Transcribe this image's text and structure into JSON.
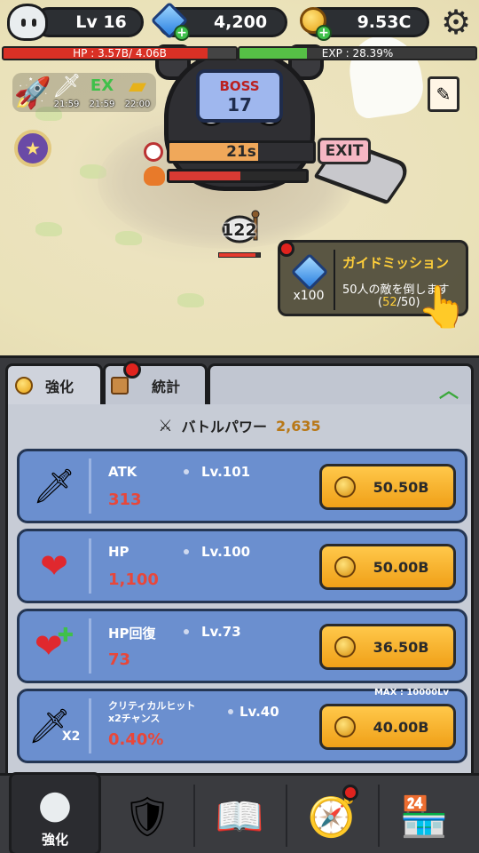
{
  "header": {
    "level": "Lv 16",
    "gems": "4,200",
    "gold": "9.53C",
    "hp_label": "HP : 3.57B/ 4.06B",
    "hp_fraction": 0.879,
    "exp_label": "EXP : 28.39%",
    "exp_fraction": 0.2839
  },
  "buffs": [
    {
      "icon": "atk-boost-icon",
      "time": "21:59"
    },
    {
      "icon": "exp-boost-icon",
      "time": "21:59"
    },
    {
      "icon": "gold-boost-icon",
      "time": "22:00"
    }
  ],
  "boss": {
    "label": "BOSS",
    "stage": "17",
    "timer": "21s",
    "timer_fraction": 0.62,
    "hp_fraction": 0.52,
    "exit_label": "EXIT"
  },
  "hero": {
    "damage": "122",
    "hp_fraction": 0.9
  },
  "guide": {
    "reward_count": "x100",
    "title": "ガイドミッション",
    "desc": "50人の敵を倒します",
    "progress_current": "52",
    "progress_total": "/50)",
    "progress_open": "("
  },
  "tabs": {
    "upgrade": "強化",
    "stats": "統計"
  },
  "battle_power": {
    "label": "バトルパワー",
    "value": "2,635"
  },
  "upgrades": [
    {
      "name": "ATK",
      "level": "Lv.101",
      "amount": "313",
      "cost": "50.50B",
      "icon": "sword-icon"
    },
    {
      "name": "HP",
      "level": "Lv.100",
      "amount": "1,100",
      "cost": "50.00B",
      "icon": "heart-icon"
    },
    {
      "name": "HP回復",
      "level": "Lv.73",
      "amount": "73",
      "cost": "36.50B",
      "icon": "heart-regen-icon"
    },
    {
      "name": "クリティカルヒット\nx2チャンス",
      "level": "Lv.40",
      "amount": "0.40%",
      "cost": "40.00B",
      "icon": "critical-sword-icon",
      "max": "MAX : 10000Lv",
      "badge": "X2"
    }
  ],
  "nav": {
    "upgrade_label": "強化"
  },
  "colors": {
    "card": "#6b8fcf",
    "button": "#f0a018",
    "amount": "#e8473a",
    "accent_gold": "#ffcf3a"
  }
}
